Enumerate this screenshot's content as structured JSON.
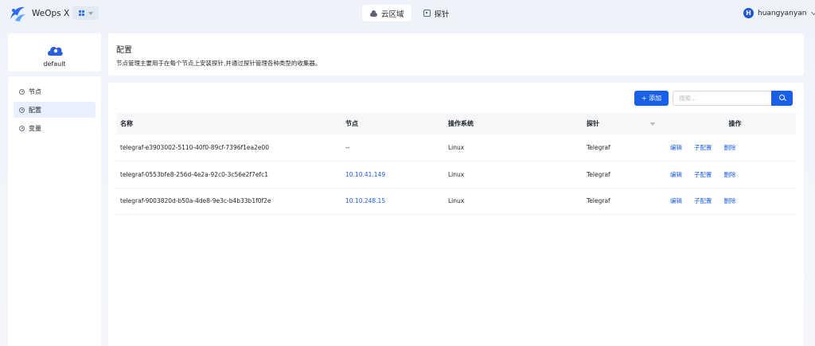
{
  "app": {
    "title": "WeOps X"
  },
  "top_nav": {
    "tabs": [
      {
        "label": "云区域",
        "active": true
      },
      {
        "label": "探针",
        "active": false
      }
    ]
  },
  "user": {
    "name": "huangyanyan",
    "initial": "H"
  },
  "cluster": {
    "name": "default"
  },
  "sidebar": {
    "items": [
      {
        "label": "节点"
      },
      {
        "label": "配置"
      },
      {
        "label": "变量"
      }
    ]
  },
  "intro": {
    "title": "配置",
    "description": "节点管理主要用于在每个节点上安装探针,并通过探针管理各种类型的收集器。"
  },
  "toolbar": {
    "add_label": "+ 添加",
    "search_placeholder": "搜索..."
  },
  "table": {
    "headers": {
      "name": "名称",
      "node": "节点",
      "os": "操作系统",
      "probe": "探针",
      "actions": "操作"
    },
    "action_labels": {
      "edit": "编辑",
      "sub_config": "子配置",
      "delete": "删除"
    },
    "rows": [
      {
        "name": "telegraf-e3903002-5110-40f0-89cf-7396f1ea2e00",
        "node": "--",
        "os": "Linux",
        "probe": "Telegraf"
      },
      {
        "name": "telegraf-0553bfe8-256d-4e2a-92c0-3c56e2f7efc1",
        "node": "10.10.41.149",
        "os": "Linux",
        "probe": "Telegraf"
      },
      {
        "name": "telegraf-9003820d-b50a-4de8-9e3c-b4b33b1f0f2e",
        "node": "10.10.248.15",
        "os": "Linux",
        "probe": "Telegraf"
      }
    ]
  },
  "colors": {
    "primary": "#1a5fe8",
    "active_nav_bg": "#e8f0fd",
    "page_bg": "#eef3fb"
  }
}
